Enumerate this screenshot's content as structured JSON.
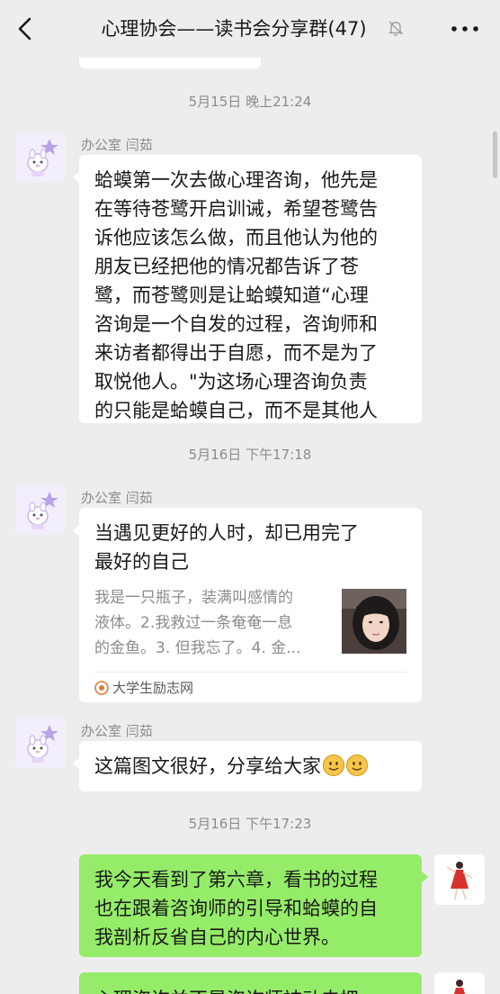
{
  "header": {
    "title": "心理协会——读书会分享群(47)"
  },
  "messages": {
    "t1": "5月15日 晚上21:24",
    "m1_sender": "办公室 闫茹",
    "m1_lines": [
      "蛤蟆第一次去做心理咨询，他先是",
      "在等待苍鹭开启训诫，希望苍鹭告",
      "诉他应该怎么做，而且他认为他的",
      "朋友已经把他的情况都告诉了苍",
      "鹭，而苍鹭则是让蛤蟆知道“心理",
      "咨询是一个自发的过程，咨询师和",
      "来访者都得出于自愿，而不是为了",
      "取悦他人。\"为这场心理咨询负责",
      "的只能是蛤蟆自己，而不是其他人"
    ],
    "t2": "5月16日 下午17:18",
    "m2_sender": "办公室 闫茹",
    "card": {
      "title_lines": [
        "当遇见更好的人时，却已用完了",
        "最好的自己"
      ],
      "desc_lines": [
        "我是一只瓶子，装满叫感情的",
        "液体。2.我救过一条奄奄一息",
        "的金鱼。3. 但我忘了。4. 金..."
      ],
      "source": "大学生励志网"
    },
    "m3_sender": "办公室 闫茹",
    "m3_text": "这篇图文很好，分享给大家",
    "t3": "5月16日 下午17:23",
    "m4_lines": [
      "我今天看到了第六章，看书的过程",
      "也在跟着咨询师的引导和蛤蟆的自",
      "我剖析反省自己的内心世界。"
    ],
    "m5_partial": "心理咨询并不是咨询师被动去把"
  },
  "colors": {
    "background": "#ededed",
    "self_bubble": "#95ec69",
    "other_bubble": "#ffffff",
    "meta_text": "#8c8c8c"
  },
  "icons": [
    "back-arrow-icon",
    "mute-bell-icon",
    "more-dots-icon",
    "source-logo-icon",
    "smile-emoji-icon"
  ]
}
